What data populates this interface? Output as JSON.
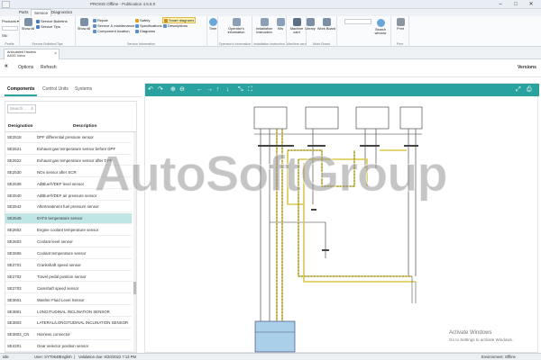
{
  "window": {
    "title": "PROSIS Offline - Publication 4.5.8.0",
    "minimize": "–",
    "maximize": "□",
    "close": "✕"
  },
  "menu_tabs": [
    "Parts",
    "Service",
    "Diagnostics"
  ],
  "ribbon": {
    "products_label": "Products",
    "field_value": "SN:",
    "bulletins": {
      "show_all": "Show all",
      "service_bulletins": "Service Bulletins",
      "service_tips": "Service Tips",
      "group_label": "Service Bulletins/Tips"
    },
    "service_info": {
      "show_all": "Show all",
      "repair": "Repair",
      "service_maintenance": "Service & maintenance",
      "component_location": "Component location",
      "safety": "Safety",
      "specifications": "Specifications",
      "diagrams": "Diagrams",
      "smart_diagrams": "Smart diagrams",
      "descriptions": "Descriptions",
      "group_label": "Service Information"
    },
    "time": "Time",
    "operators_information": "Operator's information",
    "operators_group": "Operator's Information",
    "installation_instruction": "Installation Instruction",
    "kits": "Kits",
    "installation_group": "Installation Instruction",
    "machine_card": "Machine card",
    "machine_group": "Machine card",
    "library": "Library",
    "work_board": "Work Board",
    "work_group": "Work Board",
    "search_window": "Search window",
    "print": "Print",
    "print_group": "Print",
    "profile_group": "Profile"
  },
  "doc_tab": {
    "line1": "Articulated Haulers",
    "line2": "A40G Volvo"
  },
  "toolbar": {
    "collapse": "«",
    "options": "Options",
    "refresh": "Refresh",
    "versions": "Versions"
  },
  "subtabs": [
    "Components",
    "Control Units",
    "Systems"
  ],
  "search": {
    "placeholder": "Search..."
  },
  "table": {
    "headers": [
      "Designation",
      "Description"
    ],
    "rows": [
      [
        "SE2518",
        "DPF differential pressure sensor"
      ],
      [
        "SE2521",
        "Exhaust gas temperature sensor before DPF"
      ],
      [
        "SE2522",
        "Exhaust gas temperature sensor after DPF"
      ],
      [
        "SE2530",
        "NOx sensor after SCR"
      ],
      [
        "SE2539",
        "AdBlue®/DEF level sensor"
      ],
      [
        "SE2540",
        "AdBlue®/DEF air pressure sensor"
      ],
      [
        "SE2542",
        "Aftertreatment fuel pressure sensor"
      ],
      [
        "SE2545",
        "EATS temperature sensor"
      ],
      [
        "SE2602",
        "Engine coolant temperature sensor"
      ],
      [
        "SE2603",
        "Coolant level sensor"
      ],
      [
        "SE2606",
        "Coolant temperature sensor"
      ],
      [
        "SE2701",
        "Crankshaft speed sensor"
      ],
      [
        "SE2702",
        "Travel pedal position sensor"
      ],
      [
        "SE2703",
        "Camshaft speed sensor"
      ],
      [
        "SE3601",
        "Washer Fluid Level Sensor"
      ],
      [
        "SE3801",
        "LONGITUDINAL INCLINATION SENSOR"
      ],
      [
        "SE3803",
        "LATERAL/LONGITUDINAL INCLINATION SENSOR"
      ],
      [
        "SE3803_CN",
        "Harness connector"
      ],
      [
        "SE4201",
        "Gear selector position sensor"
      ]
    ],
    "selected_index": 7
  },
  "diagram_toolbar_icons": [
    "undo-icon",
    "redo-icon",
    "zoom-in-icon",
    "zoom-out-icon",
    "arrow-left-icon",
    "arrow-right-icon",
    "arrow-up-icon",
    "arrow-down-icon",
    "collapse-icon",
    "expand-icon",
    "fit-icon",
    "print-icon"
  ],
  "watermark": "AutoSoftGroup",
  "activation": {
    "line1": "Activate Windows",
    "line2": "Go to Settings to activate Windows."
  },
  "status": {
    "left": "Idle",
    "user": "User: SYT0640",
    "lang": "English",
    "sep": "|",
    "validation": "Validation due: 6/20/2022 7:13 PM",
    "env": "Environment: Offline"
  },
  "colors": {
    "accent": "#2aa3a0",
    "selection": "#bfe6e4",
    "wire_yellow": "#d8c84a"
  }
}
